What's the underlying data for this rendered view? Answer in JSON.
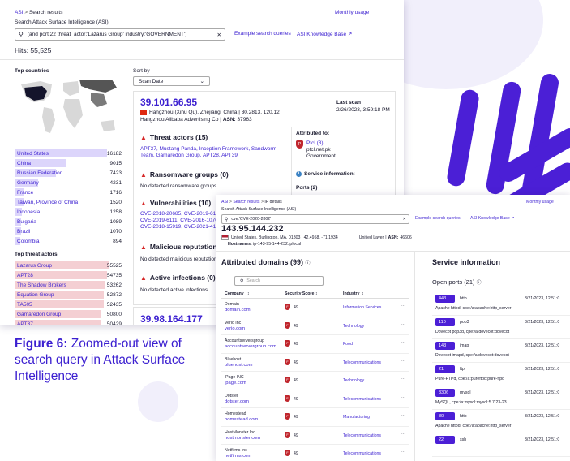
{
  "colors": {
    "brand": "#4b1fd6",
    "danger": "#d62828",
    "bar_country": "#dcd5fb",
    "bar_actor": "#f4cfd3"
  },
  "back": {
    "breadcrumb_root": "ASI",
    "breadcrumb_current": "Search results",
    "monthly_usage": "Monthly usage",
    "search_label": "Search Attack Surface Intelligence (ASI)",
    "query": "(and port:22 threat_actor:'Lazarus Group' industry:'GOVERNMENT')",
    "example_queries": "Example search queries",
    "knowledge_base": "ASI Knowledge Base",
    "hits_label": "Hits:",
    "hits_value": "55,525",
    "top_countries_title": "Top countries",
    "countries": [
      {
        "name": "United States",
        "value": "16182",
        "frac": 0.86
      },
      {
        "name": "China",
        "value": "9015",
        "frac": 0.48
      },
      {
        "name": "Russian Federation",
        "value": "7423",
        "frac": 0.39
      },
      {
        "name": "Germany",
        "value": "4231",
        "frac": 0.22
      },
      {
        "name": "France",
        "value": "1716",
        "frac": 0.09
      },
      {
        "name": "Taiwan, Province of China",
        "value": "1520",
        "frac": 0.08
      },
      {
        "name": "Indonesia",
        "value": "1258",
        "frac": 0.07
      },
      {
        "name": "Bulgaria",
        "value": "1089",
        "frac": 0.06
      },
      {
        "name": "Brazil",
        "value": "1070",
        "frac": 0.06
      },
      {
        "name": "Colombia",
        "value": "894",
        "frac": 0.05
      }
    ],
    "top_actors_title": "Top threat actors",
    "actors": [
      {
        "name": "Lazarus Group",
        "value": "55525",
        "frac": 1.0
      },
      {
        "name": "APT28",
        "value": "54735",
        "frac": 0.985
      },
      {
        "name": "The Shadow Brokers",
        "value": "53262",
        "frac": 0.96
      },
      {
        "name": "Equation Group",
        "value": "52872",
        "frac": 0.95
      },
      {
        "name": "TA505",
        "value": "52435",
        "frac": 0.945
      },
      {
        "name": "Gamaredon Group",
        "value": "50800",
        "frac": 0.915
      },
      {
        "name": "APT37",
        "value": "50429",
        "frac": 0.91
      }
    ],
    "sort_by_label": "Sort by",
    "sort_value": "Scan Date",
    "result1": {
      "ip": "39.101.66.95",
      "location": "Hangzhou (Xihu Qu), Zhejiang, China | 30.2813, 120.12",
      "org": "Hangzhou Alibaba Advertising Co",
      "asn_label": "ASN:",
      "asn": "37963",
      "last_scan_label": "Last scan",
      "last_scan": "2/26/2023, 3:59:18 PM",
      "threat_actors_title": "Threat actors (15)",
      "threat_actors": "APT37, Mustang Panda, Inception Framework, Sandworm Team, Gamaredon Group, APT28, APT39",
      "attributed_title": "Attributed to:",
      "attributed_name": "Ptcl (3)",
      "attributed_domain": "ptcl.net.pk",
      "attributed_industry": "Government",
      "service_info_title": "Service information:",
      "ports_title": "Ports (2)",
      "ransomware_title": "Ransomware groups (0)",
      "ransomware_text": "No detected ransomware groups",
      "vulns_title": "Vulnerabilities (10)",
      "vulns_line1": "CVE-2018-20685, CVE-2019-6109, ...",
      "vulns_line2": "CVE-2019-6111, CVE-2016-10708, C...",
      "vulns_line3": "CVE-2018-15919, CVE-2021-41617...",
      "malicious_title": "Malicious reputation (0)",
      "malicious_text": "No detected malicious reputation",
      "infections_title": "Active infections (0)",
      "infections_text": "No detected active infections"
    },
    "result2_ip": "39.98.164.177"
  },
  "caption": {
    "figure": "Figure 6:",
    "text": "Zoomed-out view of search query in Attack Surface Intelligence"
  },
  "front": {
    "breadcrumb_root": "ASI",
    "breadcrumb_mid": "Search results",
    "breadcrumb_current": "IP details",
    "monthly_usage": "Monthly usage",
    "search_label": "Search Attack Surface Intelligence (ASI)",
    "query": "cve:'CVE-2020-2802'",
    "example_queries": "Example search queries",
    "knowledge_base": "ASI Knowledge Base",
    "ip": "143.95.144.232",
    "location": "United States, Burlington, MA, 01803 | 42.4958, -71.1934",
    "org": "Unified Layer",
    "asn_label": "ASN:",
    "asn": "46606",
    "hostnames_label": "Hostnames:",
    "hostnames": "ip-143-95-144-232.iplocal",
    "domains_title": "Attributed domains (99)",
    "search_placeholder": "Search",
    "col_company": "Company",
    "col_score": "Security Score",
    "col_industry": "Industry",
    "domains": [
      {
        "company": "Domain",
        "domain": "domain.com",
        "score": "49",
        "industry": "Information Services"
      },
      {
        "company": "Verio Inc",
        "domain": "verio.com",
        "score": "49",
        "industry": "Technology"
      },
      {
        "company": "Accountserversgroup",
        "domain": "accountservergroup.com",
        "score": "49",
        "industry": "Food"
      },
      {
        "company": "Bluehost",
        "domain": "bluehost.com",
        "score": "49",
        "industry": "Telecommunications"
      },
      {
        "company": "iPage INC",
        "domain": "ipage.com",
        "score": "49",
        "industry": "Technology"
      },
      {
        "company": "Dotster",
        "domain": "dotster.com",
        "score": "49",
        "industry": "Telecommunications"
      },
      {
        "company": "Homestead",
        "domain": "homestead.com",
        "score": "49",
        "industry": "Manufacturing"
      },
      {
        "company": "HostMonster Inc",
        "domain": "hostmonster.com",
        "score": "49",
        "industry": "Telecommunications"
      },
      {
        "company": "Netfirms Inc",
        "domain": "netfirms.com",
        "score": "49",
        "industry": "Telecommunications"
      }
    ],
    "service_title": "Service information",
    "open_ports_title": "Open ports (21)",
    "ports": [
      {
        "port": "443",
        "proto": "http",
        "detail": "Apache httpd, cpe:/a:apache:http_server",
        "time": "3/21/2023, 12:51:0"
      },
      {
        "port": "110",
        "proto": "pop3",
        "detail": "Dovecot pop3d, cpe:/a:dovecot:dovecot",
        "time": "3/21/2023, 12:51:0"
      },
      {
        "port": "143",
        "proto": "imap",
        "detail": "Dovecot imapd, cpe:/a:dovecot:dovecot",
        "time": "3/21/2023, 12:51:0"
      },
      {
        "port": "21",
        "proto": "ftp",
        "detail": "Pure-FTPd, cpe:/a:pureftpd:pure-ftpd",
        "time": "3/21/2023, 12:51:0"
      },
      {
        "port": "3306",
        "proto": "mysql",
        "detail": "MySQL, cpe:/a:mysql:mysql:5.7.23-23",
        "time": "3/21/2023, 12:51:0"
      },
      {
        "port": "80",
        "proto": "http",
        "detail": "Apache httpd, cpe:/a:apache:http_server",
        "time": "3/21/2023, 12:51:0"
      },
      {
        "port": "22",
        "proto": "ssh",
        "detail": "",
        "time": "3/21/2023, 12:51:0"
      }
    ]
  }
}
